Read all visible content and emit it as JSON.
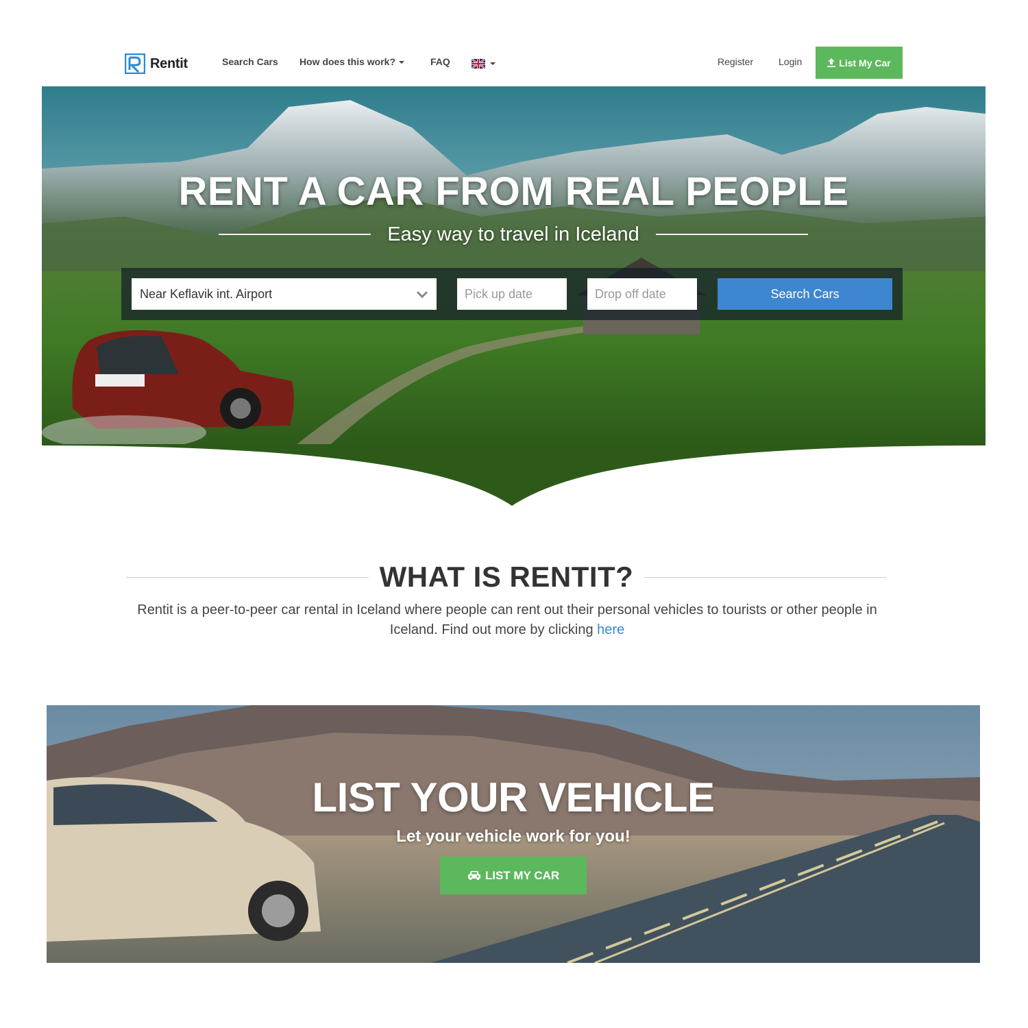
{
  "brand": {
    "name": "Rentit"
  },
  "nav": {
    "search_cars": "Search Cars",
    "how_it_works": "How does this work?",
    "faq": "FAQ",
    "register": "Register",
    "login": "Login",
    "list_my_car": "List My Car",
    "language_icon": "uk-flag-icon"
  },
  "hero": {
    "title": "RENT A CAR FROM REAL PEOPLE",
    "subtitle": "Easy way to travel in Iceland",
    "location_value": "Near Keflavik int. Airport",
    "pickup_placeholder": "Pick up date",
    "dropoff_placeholder": "Drop off date",
    "search_button": "Search Cars"
  },
  "about": {
    "title": "WHAT IS RENTIT?",
    "text": "Rentit is a peer-to-peer car rental in Iceland where people can rent out their personal vehicles to tourists or other people in Iceland. Find out more by clicking ",
    "link_text": "here"
  },
  "list_vehicle": {
    "title": "LIST YOUR VEHICLE",
    "subtitle": "Let your vehicle work for you!",
    "button": "LIST MY CAR"
  },
  "colors": {
    "green": "#5cb85c",
    "blue": "#3e87d0",
    "logo_blue": "#2a8ad4"
  }
}
